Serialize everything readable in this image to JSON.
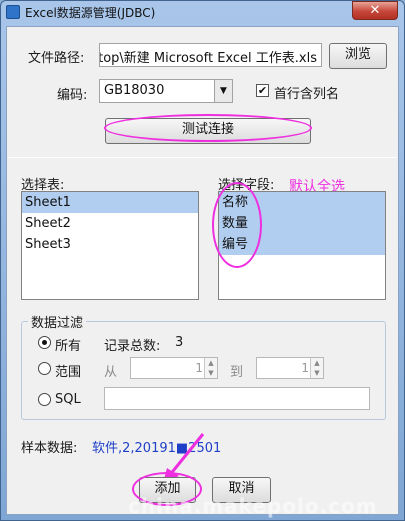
{
  "window": {
    "title": "Excel数据源管理(JDBC)",
    "close_glyph": "✕"
  },
  "file": {
    "label": "文件路径:",
    "value": "top\\新建 Microsoft Excel 工作表.xls",
    "browse_button": "浏览"
  },
  "encoding": {
    "label": "编码:",
    "value": "GB18030",
    "first_row_header": {
      "label": "首行含列名",
      "checked": true
    }
  },
  "test_button": "测试连接",
  "tables": {
    "label": "选择表:",
    "items": [
      "Sheet1",
      "Sheet2",
      "Sheet3"
    ],
    "selected": "Sheet1"
  },
  "fields": {
    "label": "选择字段:",
    "note": "默认全选",
    "items": [
      "名称",
      "数量",
      "编号"
    ]
  },
  "filter": {
    "legend": "数据过滤",
    "all": {
      "label": "所有",
      "selected": true
    },
    "record_count_label": "记录总数:",
    "record_count": "3",
    "range": {
      "label": "范围",
      "from_label": "从",
      "from_value": "1",
      "to_label": "到",
      "to_value": "1"
    },
    "sql": {
      "label": "SQL",
      "value": ""
    }
  },
  "sample": {
    "label": "样本数据:",
    "value": "软件,2,20191■2501"
  },
  "actions": {
    "add": "添加",
    "cancel": "取消"
  },
  "watermark": "china.makepolo.com",
  "colors": {
    "annotation_magenta": "#ee2fe0",
    "selection_blue": "#b1cdef",
    "sample_text_blue": "#1f3fc9"
  }
}
